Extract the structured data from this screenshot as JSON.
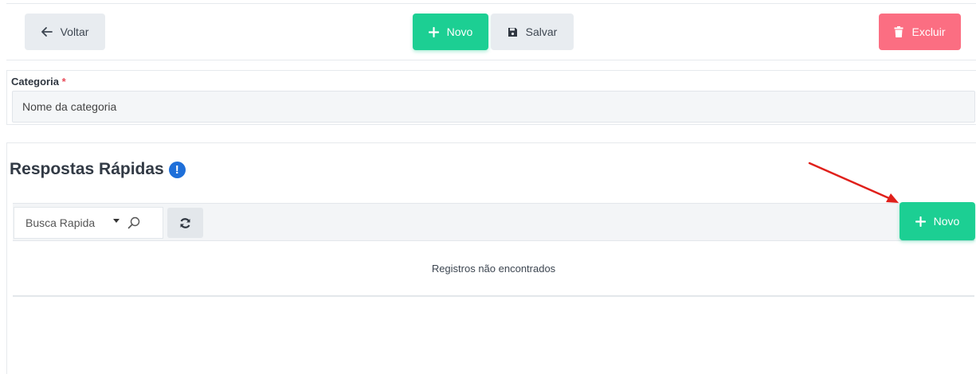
{
  "toolbar": {
    "back_label": "Voltar",
    "new_label": "Novo",
    "save_label": "Salvar",
    "delete_label": "Excluir"
  },
  "category": {
    "label": "Categoria",
    "required_mark": "*",
    "input_value": "Nome da categoria"
  },
  "quick_responses": {
    "title": "Respostas Rápidas",
    "info_icon_glyph": "!",
    "search_label": "Busca Rapida",
    "new_label": "Novo",
    "empty_message": "Registros não encontrados"
  },
  "colors": {
    "green": "#1ccf93",
    "red": "#fb6e82",
    "info_blue": "#1e6fd9",
    "annotation_arrow": "#e0201b"
  }
}
